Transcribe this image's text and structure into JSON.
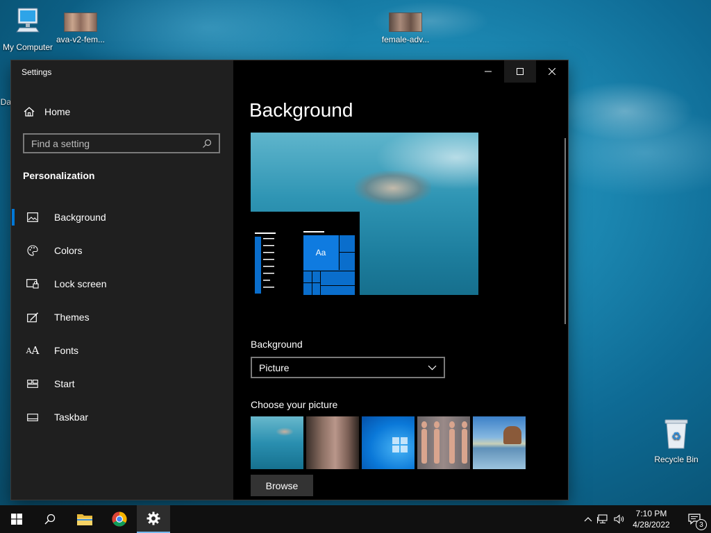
{
  "desktop": {
    "icons": [
      {
        "label": "My Computer"
      },
      {
        "label": "ava-v2-fem..."
      },
      {
        "label": "female-adv..."
      },
      {
        "label": "Da"
      },
      {
        "label": "Recycle Bin"
      }
    ]
  },
  "window": {
    "title": "Settings",
    "controls": {
      "minimize": "minimize-icon",
      "maximize": "maximize-icon",
      "close": "close-icon"
    }
  },
  "sidebar": {
    "home_label": "Home",
    "search_placeholder": "Find a setting",
    "section_title": "Personalization",
    "items": [
      {
        "label": "Background",
        "icon": "picture-icon",
        "active": true
      },
      {
        "label": "Colors",
        "icon": "palette-icon",
        "active": false
      },
      {
        "label": "Lock screen",
        "icon": "lock-screen-icon",
        "active": false
      },
      {
        "label": "Themes",
        "icon": "themes-icon",
        "active": false
      },
      {
        "label": "Fonts",
        "icon": "fonts-icon",
        "active": false
      },
      {
        "label": "Start",
        "icon": "start-icon",
        "active": false
      },
      {
        "label": "Taskbar",
        "icon": "taskbar-icon",
        "active": false
      }
    ]
  },
  "main": {
    "page_title": "Background",
    "preview_tile_text": "Aa",
    "background_label": "Background",
    "background_value": "Picture",
    "choose_picture_label": "Choose your picture",
    "browse_label": "Browse"
  },
  "taskbar": {
    "clock_time": "7:10 PM",
    "clock_date": "4/28/2022",
    "notification_count": "3",
    "accent": "#76b9ed"
  },
  "colors": {
    "accent": "#0078d7",
    "tile_blue": "#0a6ecc"
  }
}
